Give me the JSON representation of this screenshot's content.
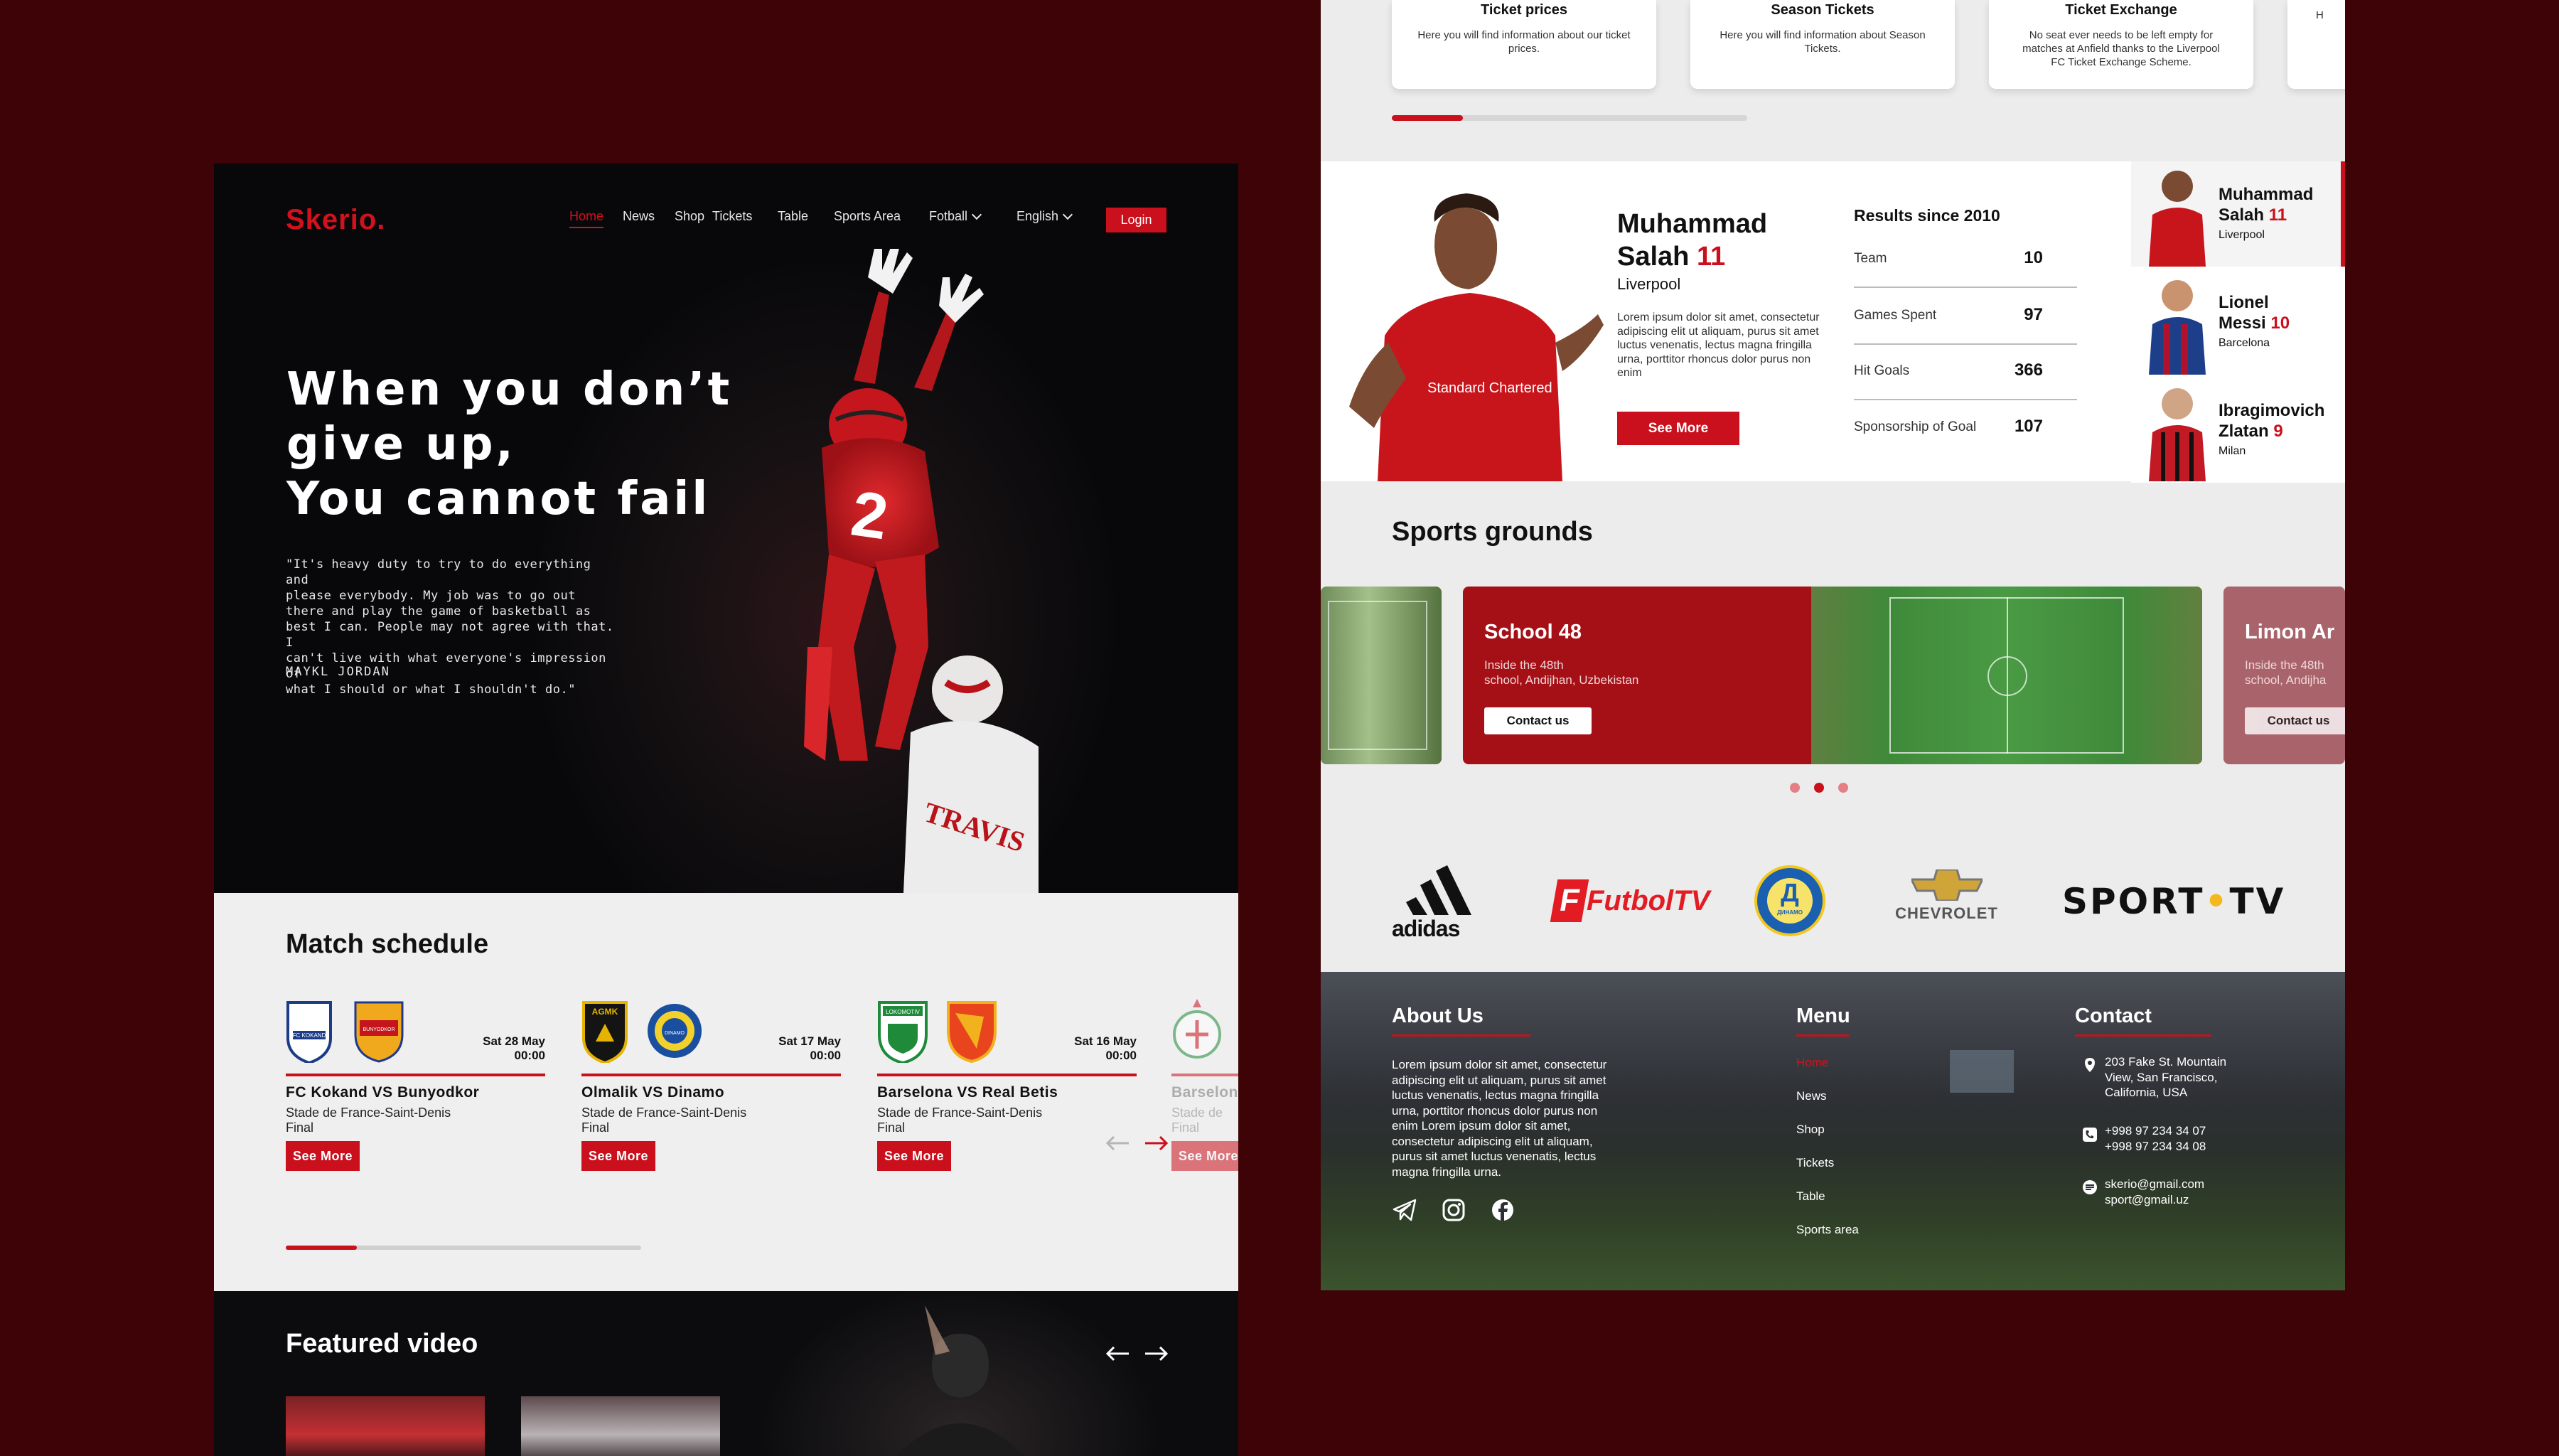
{
  "left_page": {
    "brand": "Skerio.",
    "nav": {
      "items": [
        "Home",
        "News",
        "Shop",
        "Tickets",
        "Table",
        "Sports Area",
        "Fotball",
        "English"
      ],
      "login": "Login"
    },
    "hero": {
      "title_lines": [
        "When you don’t",
        "give up,",
        "You cannot fail"
      ],
      "quote_lines": [
        "\"It's heavy duty to try to do everything and",
        "please everybody. My job was to go out",
        "there and play the game of basketball as",
        "best I can. People may not agree with that. I",
        "can't live with what everyone's impression of",
        "what I should or what I shouldn't do.\""
      ],
      "author": "MAYKL JORDAN",
      "jersey_number": "2",
      "jersey_name": "TRAVIS"
    },
    "schedule": {
      "title": "Match schedule",
      "progress": 0.2,
      "matches": [
        {
          "date": "Sat 28 May",
          "time": "00:00",
          "title": "FC Kokand VS Bunyodkor",
          "venue": "Stade de France-Saint-Denis",
          "stage": "Final",
          "button": "See More",
          "home_badge": "FC KOKAND",
          "away_badge": "BUNYODKOR"
        },
        {
          "date": "Sat 17 May",
          "time": "00:00",
          "title": "Olmalik VS Dinamo",
          "venue": "Stade de France-Saint-Denis",
          "stage": "Final",
          "button": "See More",
          "home_badge": "AGMK",
          "away_badge": "DINAMO"
        },
        {
          "date": "Sat 16 May",
          "time": "00:00",
          "title": "Barselona VS Real Betis",
          "venue": "Stade de France-Saint-Denis",
          "stage": "Final",
          "button": "See More",
          "home_badge": "LOKOMOTIV",
          "away_badge": ""
        },
        {
          "date": "",
          "time": "",
          "title": "Barselona",
          "venue": "Stade de",
          "stage": "Final",
          "button": "See More"
        }
      ]
    },
    "video": {
      "title": "Featured video"
    }
  },
  "right_page": {
    "tickets": [
      {
        "title": "Ticket prices",
        "desc": "Here you will find information about our ticket prices."
      },
      {
        "title": "Season Tickets",
        "desc": "Here you will find information about Season Tickets."
      },
      {
        "title": "Ticket Exchange",
        "desc": "No seat ever needs to be left empty for matches at Anfield thanks to the Liverpool FC Ticket Exchange Scheme."
      },
      {
        "title": "",
        "desc": "H"
      }
    ],
    "tickets_progress": 0.2,
    "player": {
      "first": "Muhammad",
      "last": "Salah",
      "number": "11",
      "club": "Liverpool",
      "desc": "Lorem ipsum dolor sit amet, consectetur adipiscing elit ut aliquam, purus sit amet luctus venenatis, lectus magna fringilla urna, porttitor rhoncus dolor purus non enim",
      "button": "See More",
      "shirt_sponsor": "Standard Chartered",
      "results_title": "Results since 2010",
      "results": [
        {
          "label": "Team",
          "value": "10"
        },
        {
          "label": "Games Spent",
          "value": "97"
        },
        {
          "label": "Hit Goals",
          "value": "366"
        },
        {
          "label": "Sponsorship of Goal",
          "value": "107"
        }
      ],
      "others": [
        {
          "name": "Muhammad",
          "surname": "Salah",
          "number": "11",
          "club": "Liverpool"
        },
        {
          "name": "Lionel",
          "surname": "Messi",
          "number": "10",
          "club": "Barcelona"
        },
        {
          "name": "Ibragimovich",
          "surname": "Zlatan",
          "number": "9",
          "club": "Milan"
        }
      ]
    },
    "grounds": {
      "title": "Sports grounds",
      "cards": [
        {
          "name": "School 48",
          "addr1": "Inside the 48th",
          "addr2": "school, Andijhan, Uzbekistan",
          "button": "Contact us"
        },
        {
          "name": "Limon Ar",
          "addr1": "Inside the 48th",
          "addr2": "school, Andijha",
          "button": "Contact us"
        }
      ],
      "active_dot": 1
    },
    "sponsors": [
      "adidas",
      "FutbolTV",
      "ДИНАМО",
      "CHEVROLET",
      "SPORT",
      "TV"
    ],
    "footer": {
      "about_title": "About Us",
      "about_lines": [
        "Lorem ipsum dolor sit amet, consectetur",
        "adipiscing elit ut aliquam, purus sit amet",
        "luctus venenatis, lectus magna fringilla",
        "urna, porttitor rhoncus dolor purus non",
        "enim Lorem ipsum dolor sit amet,",
        "consectetur adipiscing elit ut aliquam,",
        "purus sit amet luctus venenatis, lectus",
        "magna fringilla urna."
      ],
      "menu_title": "Menu",
      "menu": [
        "Home",
        "News",
        "Shop",
        "Tickets",
        "Table",
        "Sports area"
      ],
      "contact_title": "Contact",
      "address_lines": [
        "203 Fake St. Mountain",
        "View, San Francisco,",
        "California, USA"
      ],
      "phones": [
        "+998 97 234 34 07",
        "+998 97 234 34 08"
      ],
      "emails": [
        "skerio@gmail.com",
        "sport@gmail.uz"
      ]
    },
    "colors": {
      "accent": "#c9101c",
      "background": "#3d0306"
    }
  }
}
